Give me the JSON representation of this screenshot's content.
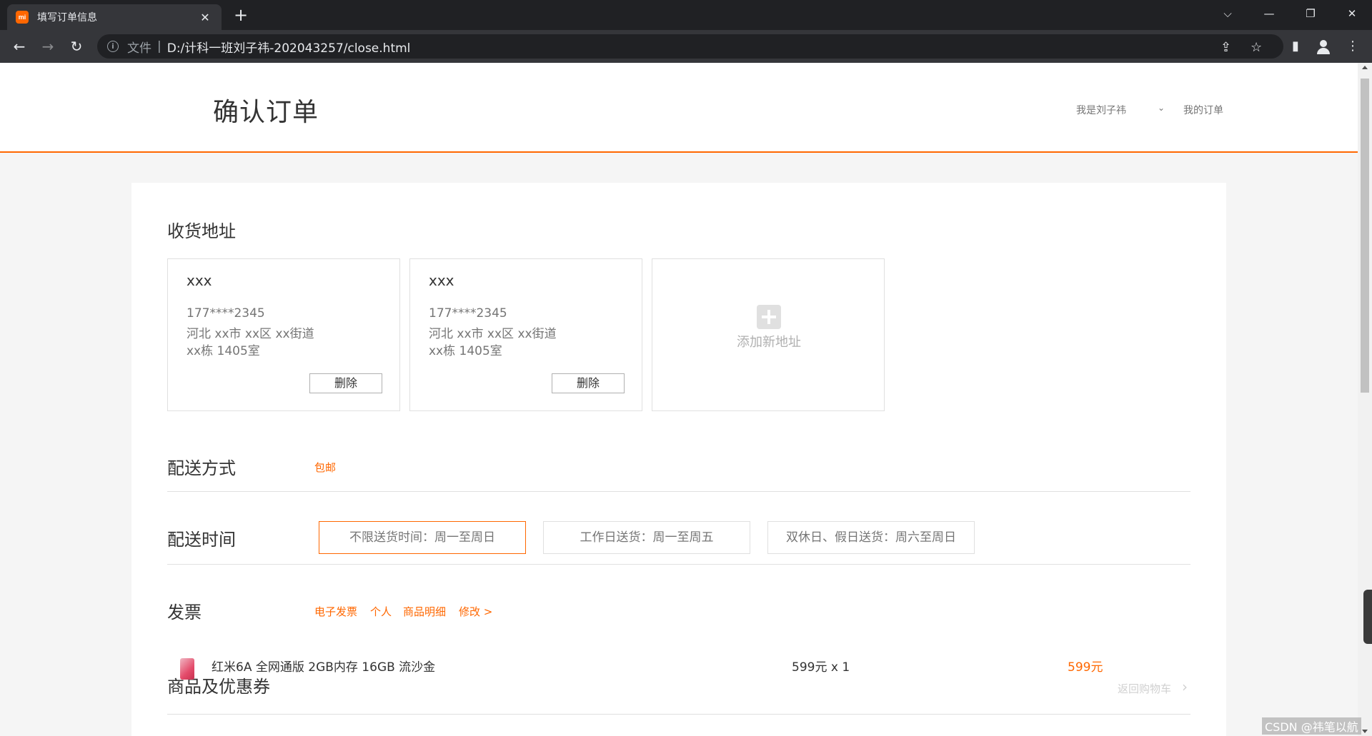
{
  "browser": {
    "tab_title": "填写订单信息",
    "favicon_text": "mi",
    "scheme_label": "文件",
    "url": "D:/计科一班刘子祎-202043257/close.html"
  },
  "header": {
    "title": "确认订单",
    "user": "我是刘子祎",
    "my_orders": "我的订单"
  },
  "address": {
    "section_title": "收货地址",
    "items": [
      {
        "name": "xxx",
        "phone": "177****2345",
        "line1": "河北 xx市 xx区 xx街道",
        "line2": "xx栋 1405室",
        "delete_label": "删除"
      },
      {
        "name": "xxx",
        "phone": "177****2345",
        "line1": "河北 xx市 xx区 xx街道",
        "line2": "xx栋 1405室",
        "delete_label": "删除"
      }
    ],
    "add_label": "添加新地址"
  },
  "shipping": {
    "section_title": "配送方式",
    "value": "包邮"
  },
  "delivery_time": {
    "section_title": "配送时间",
    "options": [
      {
        "label": "不限送货时间：周一至周日",
        "selected": true
      },
      {
        "label": "工作日送货：周一至周五",
        "selected": false
      },
      {
        "label": "双休日、假日送货：周六至周日",
        "selected": false
      }
    ]
  },
  "invoice": {
    "section_title": "发票",
    "type": "电子发票",
    "title": "个人",
    "content": "商品明细",
    "edit": "修改 >"
  },
  "products": {
    "section_title": "商品及优惠券",
    "back_to_cart": "返回购物车",
    "items": [
      {
        "name": "红米6A 全网通版 2GB内存 16GB 流沙金",
        "price_qty": "599元 x 1",
        "total": "599元"
      }
    ]
  },
  "watermark": "CSDN @祎笔以航",
  "colors": {
    "accent": "#ff6700"
  }
}
